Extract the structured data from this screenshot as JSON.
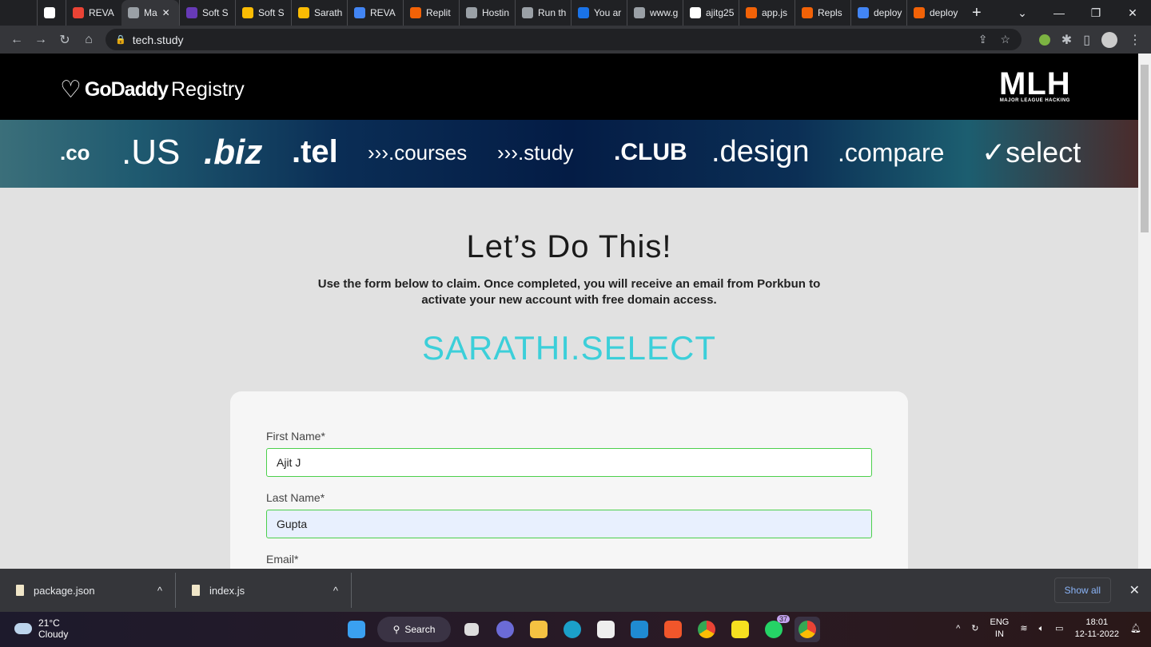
{
  "browser": {
    "tabs": [
      {
        "label": "",
        "icon": "shield-icon",
        "color": "#ffffff"
      },
      {
        "label": "REVA",
        "icon": "gmail-icon",
        "color": "#ea4335"
      },
      {
        "label": "Ma",
        "icon": "globe-icon",
        "color": "#9aa0a6",
        "active": true
      },
      {
        "label": "Soft S",
        "icon": "forms-icon",
        "color": "#673ab7"
      },
      {
        "label": "Soft S",
        "icon": "slides-icon",
        "color": "#fbbc04"
      },
      {
        "label": "Sarath",
        "icon": "slides-icon",
        "color": "#fbbc04"
      },
      {
        "label": "REVA",
        "icon": "docs-icon",
        "color": "#4285f4"
      },
      {
        "label": "Replit",
        "icon": "replit-icon",
        "color": "#f26207"
      },
      {
        "label": "Hostin",
        "icon": "globe-icon",
        "color": "#9aa0a6"
      },
      {
        "label": "Run th",
        "icon": "globe-icon",
        "color": "#9aa0a6"
      },
      {
        "label": "You ar",
        "icon": "s-icon",
        "color": "#1a73e8"
      },
      {
        "label": "www.g",
        "icon": "globe-icon",
        "color": "#9aa0a6"
      },
      {
        "label": "ajitg25",
        "icon": "github-icon",
        "color": "#ffffff"
      },
      {
        "label": "app.js",
        "icon": "replit-icon",
        "color": "#f26207"
      },
      {
        "label": "Repls",
        "icon": "replit-icon",
        "color": "#f26207"
      },
      {
        "label": "deploy",
        "icon": "google-icon",
        "color": "#4285f4"
      },
      {
        "label": "deploy",
        "icon": "replit-icon",
        "color": "#f26207"
      }
    ],
    "url": "tech.study"
  },
  "header": {
    "logo_bold": "GoDaddy",
    "logo_light": "Registry",
    "mlh": "MLH",
    "mlh_sub": "MAJOR LEAGUE HACKING"
  },
  "banner": [
    ".co",
    ".US",
    ".biz",
    ".tel",
    "›››.courses",
    "›››.study",
    ".CLUB",
    ".design",
    ".compare",
    "✓select"
  ],
  "main": {
    "title": "Let’s Do This!",
    "subtitle": "Use the form below to claim. Once completed, you will receive an email from Porkbun to activate your new account with free domain access.",
    "domain": "SARATHI.SELECT"
  },
  "form": {
    "first_name_label": "First Name*",
    "first_name": "Ajit J",
    "last_name_label": "Last Name*",
    "last_name": "Gupta",
    "email_label": "Email*"
  },
  "downloads": {
    "items": [
      "package.json",
      "index.js"
    ],
    "show_all": "Show all"
  },
  "taskbar": {
    "temp": "21°C",
    "weather": "Cloudy",
    "search": "Search",
    "badge": "37",
    "lang": "ENG",
    "region": "IN",
    "time": "18:01",
    "date": "12-11-2022"
  }
}
